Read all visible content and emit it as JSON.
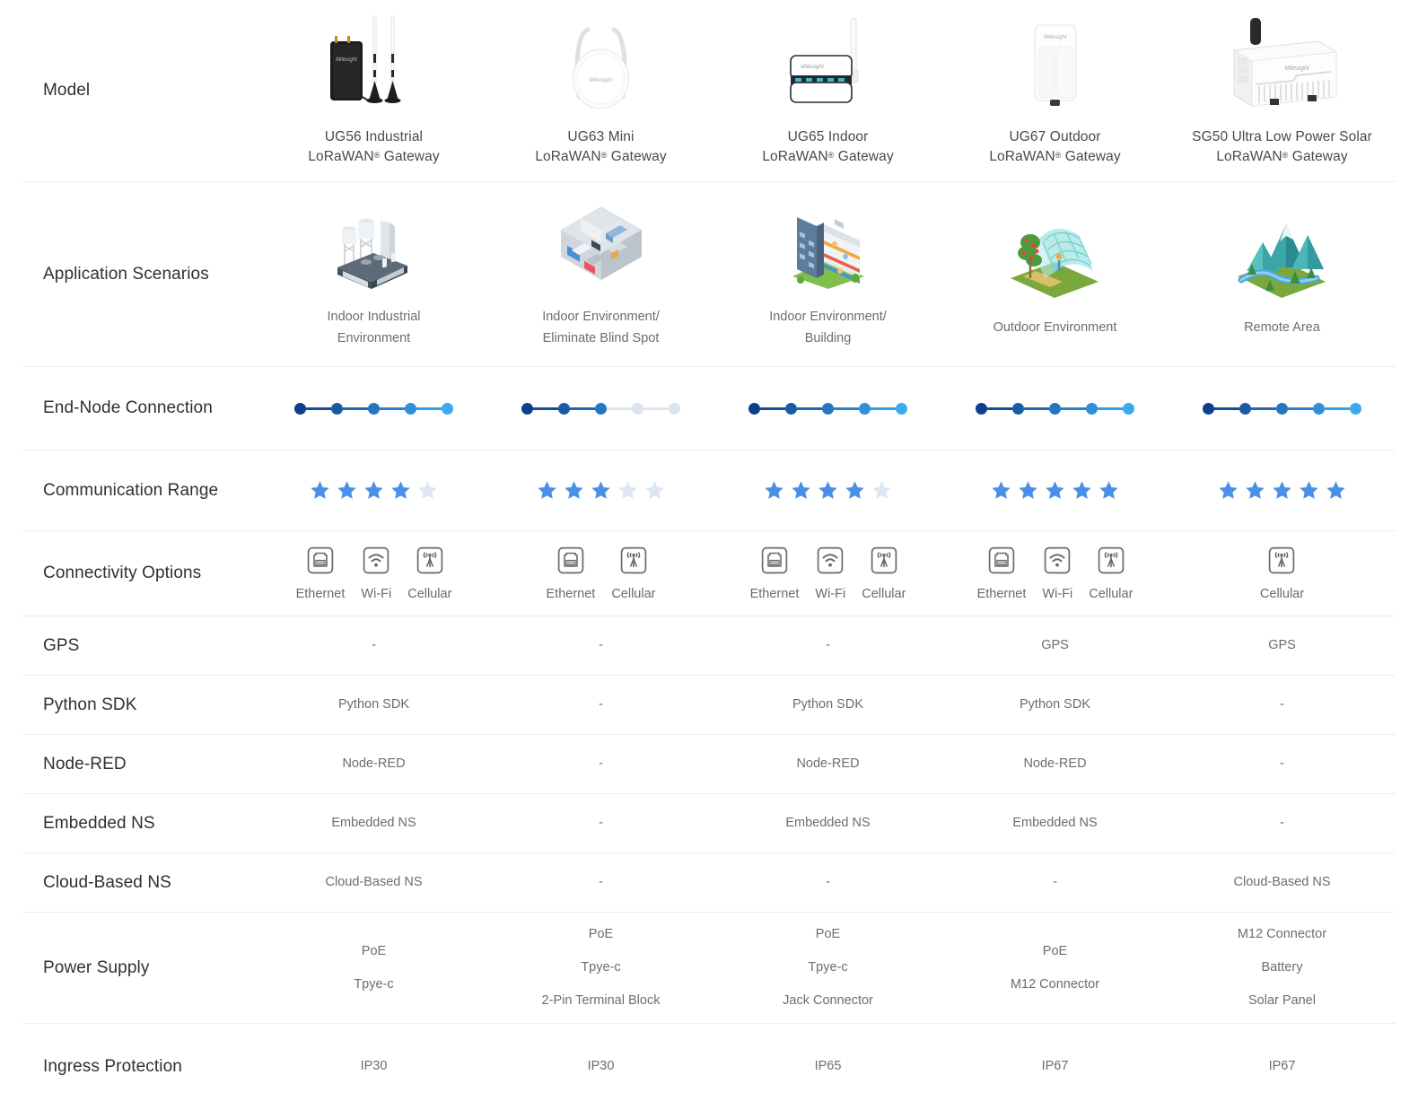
{
  "colors": {
    "label_text": "#303030",
    "value_text": "#6d6d6d",
    "divider": "#ededed",
    "dot_start": "#0d3f8f",
    "dot_end": "#3daaf0",
    "dot_inactive": "#dbe4ef",
    "star_filled": "#4a90e8",
    "star_empty": "#dde6f2",
    "icon_stroke": "#6a6a6a"
  },
  "columns": [
    {
      "id": "ug56",
      "name_line1": "UG56 Industrial",
      "name_line2": "LoRaWAN",
      "name_line3": " Gateway",
      "product_icon": "ug56-industrial-gateway-photo"
    },
    {
      "id": "ug63",
      "name_line1": "UG63 Mini",
      "name_line2": "LoRaWAN",
      "name_line3": " Gateway",
      "product_icon": "ug63-mini-gateway-photo"
    },
    {
      "id": "ug65",
      "name_line1": "UG65 Indoor",
      "name_line2": "LoRaWAN",
      "name_line3": " Gateway",
      "product_icon": "ug65-indoor-gateway-photo"
    },
    {
      "id": "ug67",
      "name_line1": "UG67 Outdoor",
      "name_line2": "LoRaWAN",
      "name_line3": " Gateway",
      "product_icon": "ug67-outdoor-gateway-photo"
    },
    {
      "id": "sg50",
      "name_line1": "SG50 Ultra Low Power Solar",
      "name_line2": "LoRaWAN",
      "name_line3": " Gateway",
      "product_icon": "sg50-solar-gateway-photo"
    }
  ],
  "rows": {
    "model": {
      "label": "Model"
    },
    "application": {
      "label": "Application\nScenarios",
      "values": [
        "Indoor Industrial\nEnvironment",
        "Indoor Environment/\nEliminate Blind Spot",
        "Indoor Environment/\nBuilding",
        "Outdoor Environment",
        "Remote Area"
      ],
      "icons": [
        "factory-isometric-icon",
        "indoor-rooms-isometric-icon",
        "building-isometric-icon",
        "greenhouse-isometric-icon",
        "mountains-isometric-icon"
      ]
    },
    "end_node_connection": {
      "label": "End-Node\nConnection",
      "active_dots": [
        5,
        3,
        5,
        5,
        5
      ],
      "total_dots": 5
    },
    "communication_range": {
      "label": "Communication\nRange",
      "ratings": [
        4,
        3,
        4,
        5,
        5
      ],
      "max": 5
    },
    "connectivity_options": {
      "label": "Connectivity\nOptions",
      "values": [
        [
          "Ethernet",
          "Wi-Fi",
          "Cellular"
        ],
        [
          "Ethernet",
          "Cellular"
        ],
        [
          "Ethernet",
          "Wi-Fi",
          "Cellular"
        ],
        [
          "Ethernet",
          "Wi-Fi",
          "Cellular"
        ],
        [
          "Cellular"
        ]
      ]
    },
    "gps": {
      "label": "GPS",
      "values": [
        "-",
        "-",
        "-",
        "GPS",
        "GPS"
      ]
    },
    "python_sdk": {
      "label": "Python SDK",
      "values": [
        "Python SDK",
        "-",
        "Python SDK",
        "Python SDK",
        "-"
      ]
    },
    "node_red": {
      "label": "Node-RED",
      "values": [
        "Node-RED",
        "-",
        "Node-RED",
        "Node-RED",
        "-"
      ]
    },
    "embedded_ns": {
      "label": "Embedded NS",
      "values": [
        "Embedded NS",
        "-",
        "Embedded NS",
        "Embedded NS",
        "-"
      ]
    },
    "cloud_based_ns": {
      "label": "Cloud-Based NS",
      "values": [
        "Cloud-Based NS",
        "-",
        "-",
        "-",
        "Cloud-Based NS"
      ]
    },
    "power_supply": {
      "label": "Power Supply",
      "values": [
        "PoE\nTpye-c",
        "PoE\nTpye-c\n2-Pin Terminal Block",
        "PoE\nTpye-c\nJack Connector",
        "PoE\nM12 Connector",
        "M12 Connector\nBattery\nSolar Panel"
      ]
    },
    "ingress_protection": {
      "label": "Ingress Protection",
      "values": [
        "IP30",
        "IP30",
        "IP65",
        "IP67",
        "IP67"
      ]
    }
  }
}
